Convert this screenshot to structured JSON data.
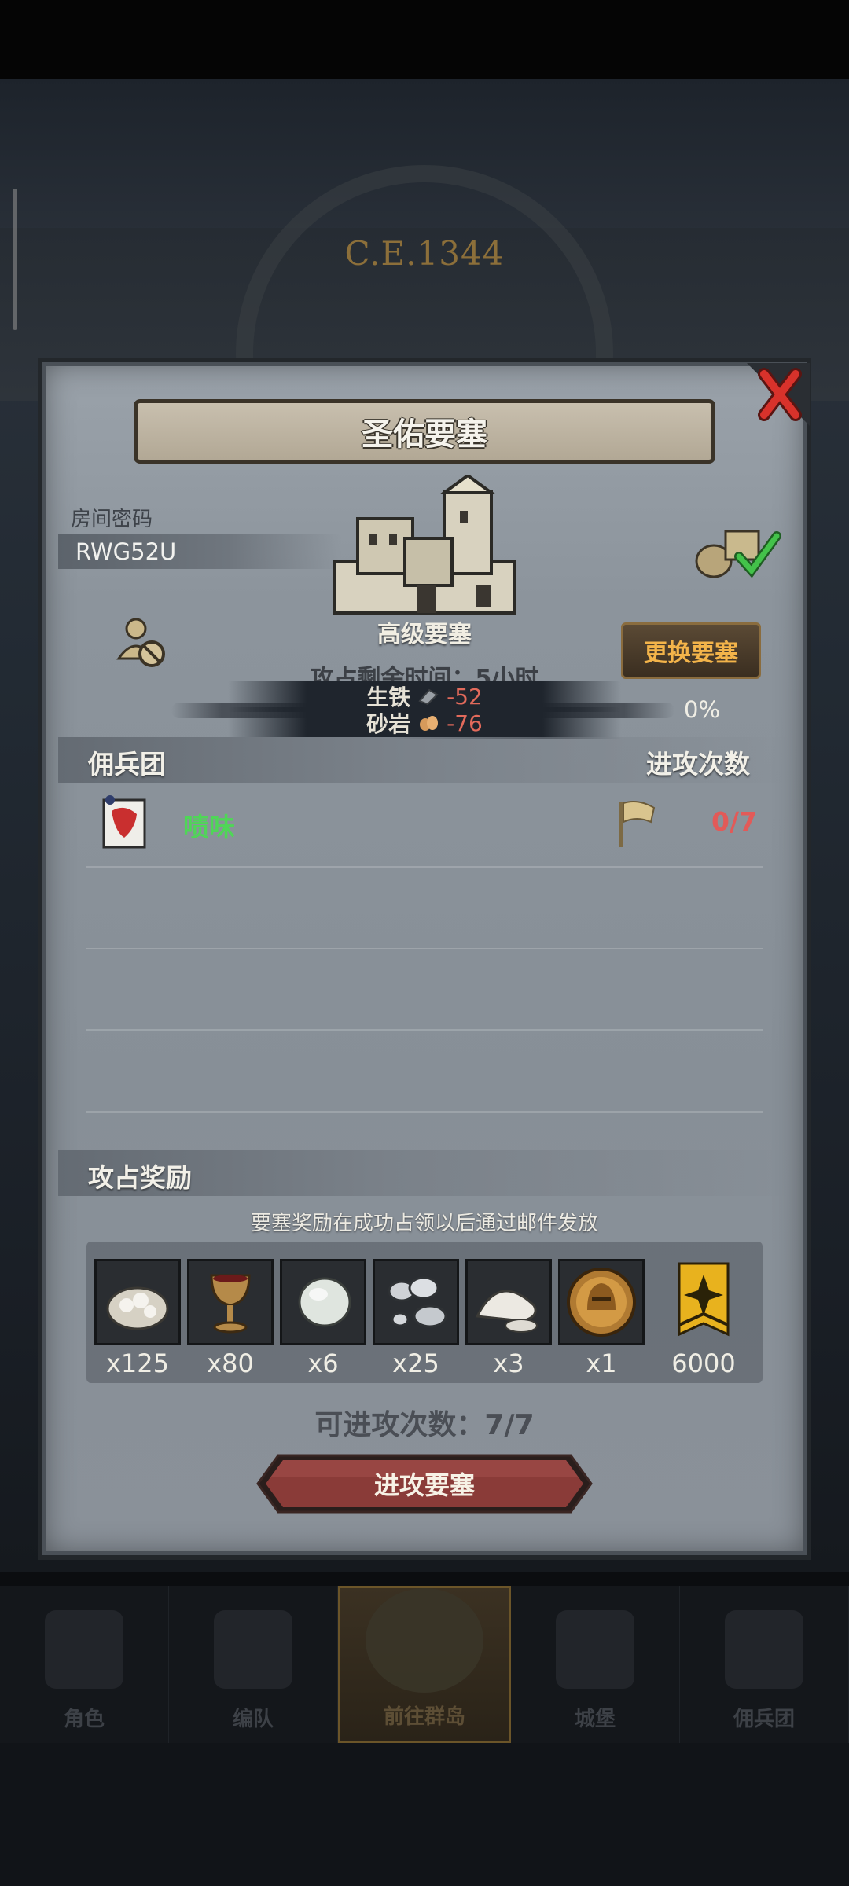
{
  "background": {
    "era_label": "C.E.1344"
  },
  "dialog": {
    "title": "圣佑要塞",
    "room_label": "房间密码",
    "room_code": "RWG52U",
    "fortress_type": "高级要塞",
    "change_button": "更换要塞",
    "remaining_time": "攻占剩余时间：5小时",
    "progress_percent": 0,
    "progress_label": "0%",
    "costs": [
      {
        "name": "生铁",
        "value": "-52",
        "icon": "iron-icon"
      },
      {
        "name": "砂岩",
        "value": "-76",
        "icon": "sandstone-icon"
      }
    ],
    "mercenary_header": "佣兵团",
    "attack_count_header": "进攻次数",
    "mercenary": {
      "name": "啧味",
      "attacks": "0/7"
    },
    "reward_header": "攻占奖励",
    "reward_note": "要塞奖励在成功占领以后通过邮件发放",
    "rewards": [
      {
        "icon": "cotton-icon",
        "qty": "x125"
      },
      {
        "icon": "goblet-icon",
        "qty": "x80"
      },
      {
        "icon": "gem-icon",
        "qty": "x6"
      },
      {
        "icon": "silver-ore-icon",
        "qty": "x25"
      },
      {
        "icon": "salt-icon",
        "qty": "x3"
      },
      {
        "icon": "helmet-medal-icon",
        "qty": "x1"
      },
      {
        "icon": "honor-badge-icon",
        "qty": "6000"
      }
    ],
    "attacks_available": "可进攻次数：7/7",
    "attack_button": "进攻要塞"
  },
  "bottom_nav": [
    {
      "label": "角色",
      "active": false
    },
    {
      "label": "编队",
      "active": false
    },
    {
      "label": "前往群岛",
      "active": true
    },
    {
      "label": "城堡",
      "active": false
    },
    {
      "label": "佣兵团",
      "active": false
    }
  ],
  "colors": {
    "positive": "#4fd657",
    "negative": "#e25a58",
    "accent_gold": "#f3b44a",
    "button_red": "#8a3b38"
  }
}
